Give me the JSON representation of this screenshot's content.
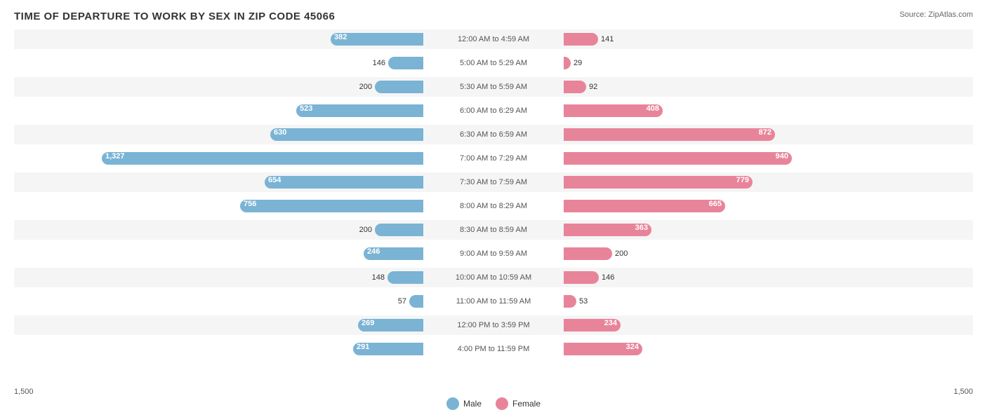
{
  "title": "TIME OF DEPARTURE TO WORK BY SEX IN ZIP CODE 45066",
  "source": "Source: ZipAtlas.com",
  "axis": {
    "left": "1,500",
    "right": "1,500"
  },
  "legend": {
    "male_label": "Male",
    "female_label": "Female",
    "male_color": "#7ab3d4",
    "female_color": "#e8849a"
  },
  "rows": [
    {
      "time": "12:00 AM to 4:59 AM",
      "male": 382,
      "female": 141
    },
    {
      "time": "5:00 AM to 5:29 AM",
      "male": 146,
      "female": 29
    },
    {
      "time": "5:30 AM to 5:59 AM",
      "male": 200,
      "female": 92
    },
    {
      "time": "6:00 AM to 6:29 AM",
      "male": 523,
      "female": 408
    },
    {
      "time": "6:30 AM to 6:59 AM",
      "male": 630,
      "female": 872
    },
    {
      "time": "7:00 AM to 7:29 AM",
      "male": 1327,
      "female": 940
    },
    {
      "time": "7:30 AM to 7:59 AM",
      "male": 654,
      "female": 779
    },
    {
      "time": "8:00 AM to 8:29 AM",
      "male": 756,
      "female": 665
    },
    {
      "time": "8:30 AM to 8:59 AM",
      "male": 200,
      "female": 363
    },
    {
      "time": "9:00 AM to 9:59 AM",
      "male": 246,
      "female": 200
    },
    {
      "time": "10:00 AM to 10:59 AM",
      "male": 148,
      "female": 146
    },
    {
      "time": "11:00 AM to 11:59 AM",
      "male": 57,
      "female": 53
    },
    {
      "time": "12:00 PM to 3:59 PM",
      "male": 269,
      "female": 234
    },
    {
      "time": "4:00 PM to 11:59 PM",
      "male": 291,
      "female": 324
    }
  ]
}
